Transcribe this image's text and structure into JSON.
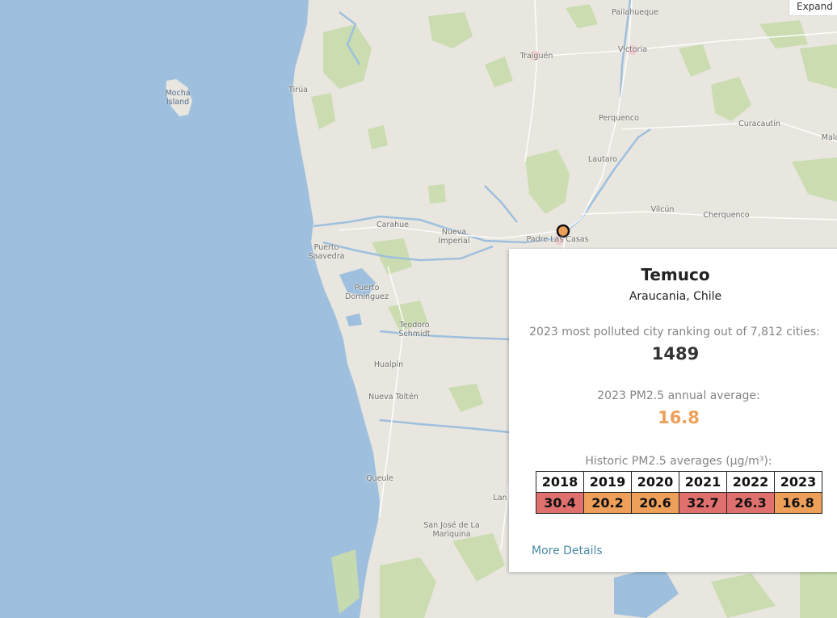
{
  "expand_label": "Expand",
  "map": {
    "places": [
      {
        "id": "pailahueque",
        "name": "Pailahueque",
        "sea": false
      },
      {
        "id": "traiguen",
        "name": "Traiguén",
        "sea": false
      },
      {
        "id": "victoria",
        "name": "Victoria",
        "sea": false
      },
      {
        "id": "tirua",
        "name": "Tirúa",
        "sea": false
      },
      {
        "id": "mocha",
        "name": "Mocha\nIsland",
        "sea": true
      },
      {
        "id": "perquenco",
        "name": "Perquenco",
        "sea": false
      },
      {
        "id": "curacautin",
        "name": "Curacautín",
        "sea": false
      },
      {
        "id": "malalcahuello",
        "name": "Mala",
        "sea": false
      },
      {
        "id": "lautaro",
        "name": "Lautaro",
        "sea": false
      },
      {
        "id": "vilcun",
        "name": "Vilcún",
        "sea": false
      },
      {
        "id": "cherquenco",
        "name": "Cherquenco",
        "sea": false
      },
      {
        "id": "carahue",
        "name": "Carahue",
        "sea": false
      },
      {
        "id": "nueva-imperial",
        "name": "Nueva\nImperial",
        "sea": false
      },
      {
        "id": "padre-las-casas",
        "name": "Padre Las Casas",
        "sea": false
      },
      {
        "id": "puerto-saavedra",
        "name": "Puerto\nSaavedra",
        "sea": false
      },
      {
        "id": "puerto-dominguez",
        "name": "Puerto\nDomínguez",
        "sea": false
      },
      {
        "id": "teodoro-schmidt",
        "name": "Teodoro\nSchmidt",
        "sea": false
      },
      {
        "id": "hualpin",
        "name": "Hualpín",
        "sea": false
      },
      {
        "id": "nueva-tolten",
        "name": "Nueva Toltén",
        "sea": false
      },
      {
        "id": "queule",
        "name": "Queule",
        "sea": false
      },
      {
        "id": "lanco",
        "name": "Lan",
        "sea": false
      },
      {
        "id": "san-jose",
        "name": "San José de La\nMariquina",
        "sea": false
      }
    ],
    "marker": {
      "label": "Temuco",
      "color": "#eea05a"
    }
  },
  "popup": {
    "city": "Temuco",
    "region": "Araucania, Chile",
    "ranking_label": "2023 most polluted city ranking out of 7,812 cities:",
    "ranking_value": "1489",
    "annual_label": "2023 PM2.5 annual average:",
    "annual_value": "16.8",
    "annual_color": "#eea05a",
    "historic_label": "Historic PM2.5 averages (µg/m³):",
    "history": [
      {
        "year": "2018",
        "value": "30.4",
        "color": "#e0706d"
      },
      {
        "year": "2019",
        "value": "20.2",
        "color": "#eea05a"
      },
      {
        "year": "2020",
        "value": "20.6",
        "color": "#eea05a"
      },
      {
        "year": "2021",
        "value": "32.7",
        "color": "#e0706d"
      },
      {
        "year": "2022",
        "value": "26.3",
        "color": "#e0706d"
      },
      {
        "year": "2023",
        "value": "16.8",
        "color": "#eea05a"
      }
    ],
    "more_link": "More Details"
  }
}
